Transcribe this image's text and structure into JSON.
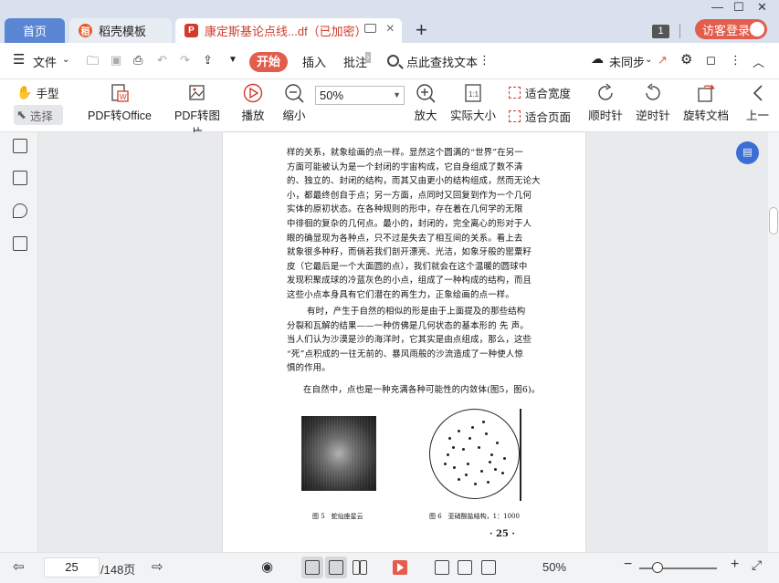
{
  "window": {
    "minimize": "—",
    "maximize": "☐",
    "close": "✕"
  },
  "tabs": [
    {
      "label": "首页"
    },
    {
      "label": "稻壳模板"
    },
    {
      "label": "康定斯基论点线...df（已加密）"
    }
  ],
  "tabbar": {
    "new_tab": "+",
    "window_count": "1",
    "guest_login": "访客登录"
  },
  "menu": {
    "file": "文件",
    "items": [
      "开始",
      "插入",
      "批注"
    ],
    "search_text": "点此查找文本",
    "sync": "未同步"
  },
  "ribbon": {
    "hand": "手型",
    "select": "选择",
    "pdf_to_office": "PDF转Office",
    "pdf_to_image": "PDF转图片",
    "play": "播放",
    "zoom_out": "缩小",
    "zoom_value": "50%",
    "zoom_in": "放大",
    "actual_size": "实际大小",
    "fit_width": "适合宽度",
    "fit_page": "适合页面",
    "rotate_cw": "顺时针",
    "rotate_ccw": "逆时针",
    "rotate_doc": "旋转文档",
    "prev": "上一"
  },
  "document": {
    "para1": [
      "样的关系，就象绘画的点一样。显然这个圆满的“世界”在另一",
      "方面可能被认为是一个封闭的宇宙构成，它自身组成了数不清",
      "的、独立的、封闭的结构，而其又由更小的结构组成，然而无论大",
      "小，都最终创自于点；另一方面，点同时又回复到作为一个几何",
      "实体的原初状态。在各种规则的形中，存在着在几何学的无限",
      "中徘徊的复杂的几何点。最小的，封闭的，完全离心的形对于人",
      "眼的确显现为各种点，只不过是失去了相互间的关系。看上去",
      "就象很多种籽，而倘若我们剖开漂亮、光洁，如象牙般的罂粟籽",
      "皮（它最后是一个大面圆的点），我们就会在这个温暖的圆球中",
      "发现积聚成球的冷蓝灰色的小点，组成了一种构成的结构，而且",
      "这些小点本身具有它们潜在的再生力，正象绘画的点一样。"
    ],
    "para2": [
      "有时，产生于自然的相似的形是由于上面提及的那些结构",
      "分裂和瓦解的结果——一种仿佛是几何状态的基本形的 先 声。",
      "当人们认为沙漠是沙的海洋时，它其实是由点组成，那么，这些",
      "“死”点积成的一往无前的、暴风雨般的沙流造成了一种使人惊",
      "惧的作用。"
    ],
    "para3": "在自然中，点也是一种充满各种可能性的内敛体(图5，图6)。",
    "fig5_caption": "图 5　蛇仙座星云",
    "fig6_caption": "图 6　亚硝酸盐结构，1：1000",
    "page_footer": "· 25 ·"
  },
  "status": {
    "current_page": "25",
    "total_pages": "/148页",
    "zoom": "50%"
  }
}
